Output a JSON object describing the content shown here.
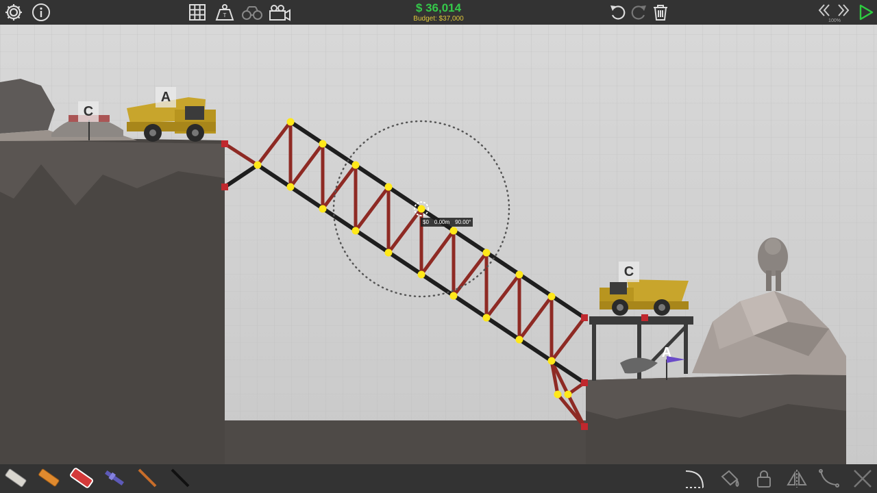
{
  "topbar": {
    "money": "$ 36,014",
    "budget": "Budget: $37,000",
    "speed": "100%"
  },
  "icons": {
    "settings": "gear-icon",
    "info": "info-icon",
    "grid": "grid-icon",
    "weight": "weight-icon",
    "binoculars": "binoculars-icon",
    "camera": "camera-icon",
    "undo": "undo-icon",
    "redo": "redo-icon",
    "delete": "trash-icon",
    "slow_down": "rewind-icon",
    "speed_up": "fast-forward-icon",
    "play": "play-icon"
  },
  "scene": {
    "labels": {
      "truck_left": "A",
      "checkpoint_left": "C",
      "truck_right": "C",
      "checkpoint_right": "A"
    },
    "tooltip": {
      "cost": "$0",
      "length": "0.00m",
      "angle": "90.00°"
    }
  },
  "materials": [
    {
      "name": "road",
      "selected": false
    },
    {
      "name": "wood",
      "selected": false
    },
    {
      "name": "reinforced-road",
      "selected": true
    },
    {
      "name": "hydraulic",
      "selected": false
    },
    {
      "name": "rope",
      "selected": false
    },
    {
      "name": "steel",
      "selected": false
    }
  ],
  "colors": {
    "joint": "#ffe81a",
    "anchor": "#c0282e",
    "beam": "#8e2a24",
    "road": "#1e1e1e",
    "money": "#35c94a",
    "budget": "#e0c83c",
    "play": "#2ecc40"
  }
}
